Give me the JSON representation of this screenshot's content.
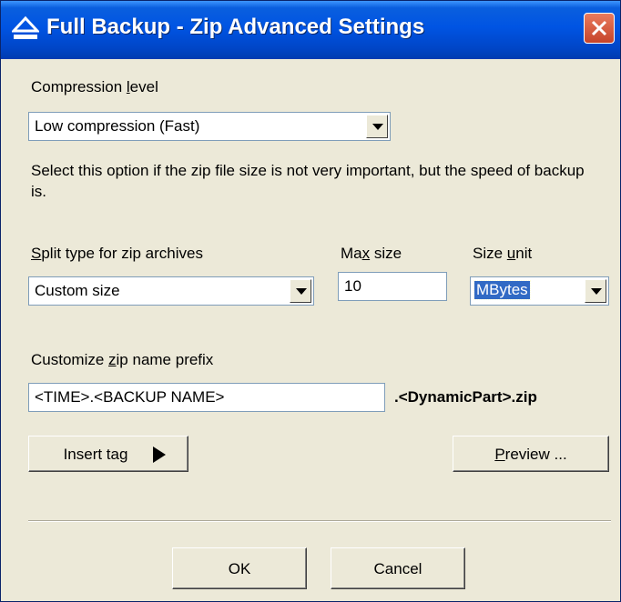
{
  "window": {
    "title": "Full Backup - Zip Advanced Settings"
  },
  "compression": {
    "label_pre": "Compression ",
    "label_accel": "l",
    "label_post": "evel",
    "value": "Low compression (Fast)",
    "description": "Select this option if the zip file size is not very important, but the speed of backup is."
  },
  "split": {
    "label_accel": "S",
    "label_post": "plit type for zip archives",
    "value": "Custom size"
  },
  "max_size": {
    "label_pre": "Ma",
    "label_accel": "x",
    "label_post": " size",
    "value": "10"
  },
  "size_unit": {
    "label_pre": "Size ",
    "label_accel": "u",
    "label_post": "nit",
    "value": "MBytes"
  },
  "prefix": {
    "label_pre": "Customize ",
    "label_accel": "z",
    "label_post": "ip name prefix",
    "value": "<TIME>.<BACKUP NAME>",
    "suffix": ".<DynamicPart>.zip"
  },
  "buttons": {
    "insert_tag": "Insert tag",
    "preview_accel": "P",
    "preview_post": "review ...",
    "ok": "OK",
    "cancel": "Cancel"
  },
  "icons": {
    "title_icon": "eject-icon",
    "close": "close-icon",
    "dropdown": "chevron-down-icon",
    "insert_arrow": "triangle-right-icon"
  },
  "colors": {
    "titlebar": "#0054e3",
    "close": "#c6442a",
    "dialog_bg": "#ece9d8",
    "selection": "#316ac5"
  }
}
